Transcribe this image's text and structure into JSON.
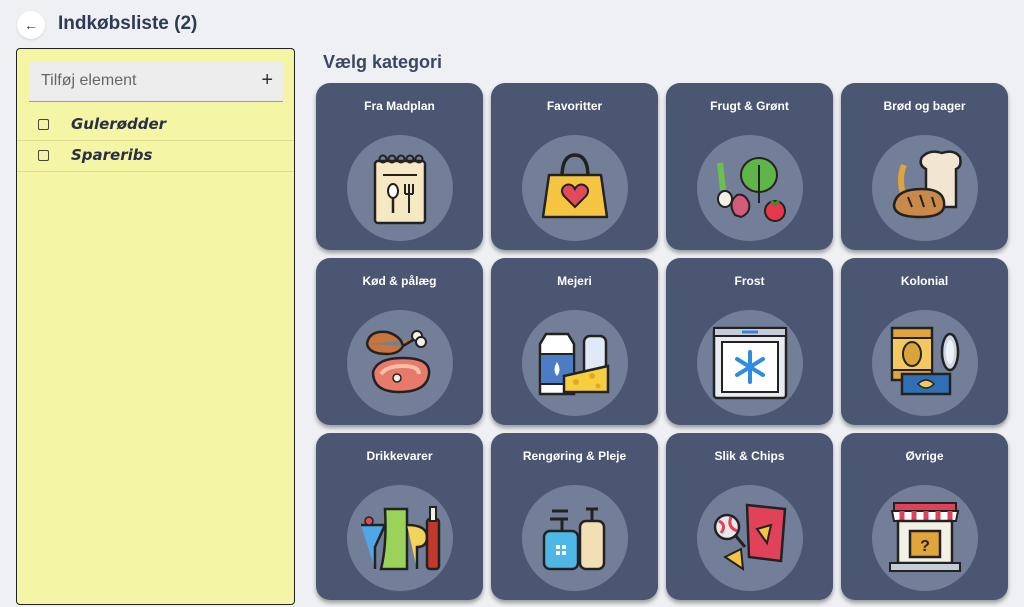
{
  "header": {
    "title": "Indkøbsliste (2)",
    "back_icon": "arrow-left-icon"
  },
  "list": {
    "add_placeholder": "Tilføj element",
    "add_icon": "plus-icon",
    "items": [
      {
        "label": "Gulerødder",
        "checked": false
      },
      {
        "label": "Spareribs",
        "checked": false
      }
    ]
  },
  "categories": {
    "title": "Vælg kategori",
    "tiles": [
      {
        "label": "Fra Madplan",
        "icon": "meal-plan-notebook-icon"
      },
      {
        "label": "Favoritter",
        "icon": "favorite-bag-icon"
      },
      {
        "label": "Frugt & Grønt",
        "icon": "vegetables-icon"
      },
      {
        "label": "Brød og bager",
        "icon": "bread-icon"
      },
      {
        "label": "Kød & pålæg",
        "icon": "meat-icon"
      },
      {
        "label": "Mejeri",
        "icon": "dairy-icon"
      },
      {
        "label": "Frost",
        "icon": "freezer-icon"
      },
      {
        "label": "Kolonial",
        "icon": "canned-goods-icon"
      },
      {
        "label": "Drikkevarer",
        "icon": "drinks-icon"
      },
      {
        "label": "Rengøring & Pleje",
        "icon": "cleaning-bottles-icon"
      },
      {
        "label": "Slik & Chips",
        "icon": "candy-chips-icon"
      },
      {
        "label": "Øvrige",
        "icon": "shop-icon"
      }
    ]
  },
  "colors": {
    "panel": "#f5f5a6",
    "tile": "#4b5772",
    "tile_circle": "#737f99",
    "title": "#2c3a55"
  }
}
